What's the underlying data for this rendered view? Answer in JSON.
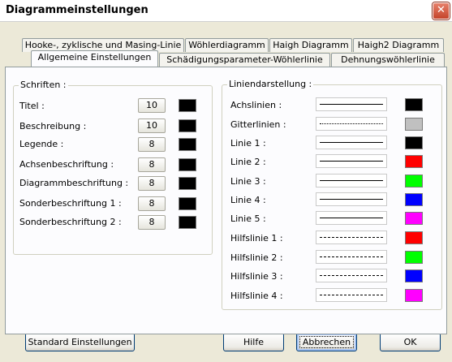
{
  "window": {
    "title": "Diagrammeinstellungen",
    "close_glyph": "✕"
  },
  "tabs_row1": [
    {
      "label": "Hooke-, zyklische und Masing-Linie"
    },
    {
      "label": "Wöhlerdiagramm"
    },
    {
      "label": "Haigh Diagramm"
    },
    {
      "label": "Haigh2 Diagramm"
    }
  ],
  "tabs_row2": [
    {
      "label": "Allgemeine Einstellungen",
      "active": true
    },
    {
      "label": "Schädigungsparameter-Wöhlerlinie"
    },
    {
      "label": "Dehnungswöhlerlinie"
    }
  ],
  "schriften": {
    "title": "Schriften :",
    "rows": [
      {
        "label": "Titel :",
        "size": "10",
        "color": "#000000"
      },
      {
        "label": "Beschreibung :",
        "size": "10",
        "color": "#000000"
      },
      {
        "label": "Legende :",
        "size": "8",
        "color": "#000000"
      },
      {
        "label": "Achsenbeschriftung :",
        "size": "8",
        "color": "#000000"
      },
      {
        "label": "Diagrammbeschriftung :",
        "size": "8",
        "color": "#000000"
      },
      {
        "label": "Sonderbeschriftung 1 :",
        "size": "8",
        "color": "#000000"
      },
      {
        "label": "Sonderbeschriftung 2 :",
        "size": "8",
        "color": "#000000"
      }
    ]
  },
  "linien": {
    "title": "Liniendarstellung :",
    "rows": [
      {
        "label": "Achslinien :",
        "style": "solid",
        "color": "#000000"
      },
      {
        "label": "Gitterlinien :",
        "style": "dotted",
        "color": "#C0C0C0"
      },
      {
        "label": "Linie 1 :",
        "style": "solid",
        "color": "#000000"
      },
      {
        "label": "Linie 2 :",
        "style": "solid",
        "color": "#FF0000"
      },
      {
        "label": "Linie 3 :",
        "style": "solid",
        "color": "#00FF00"
      },
      {
        "label": "Linie 4 :",
        "style": "solid",
        "color": "#0000FF"
      },
      {
        "label": "Linie 5 :",
        "style": "solid",
        "color": "#FF00FF"
      },
      {
        "label": "Hilfslinie 1 :",
        "style": "dashed",
        "color": "#FF0000"
      },
      {
        "label": "Hilfslinie 2 :",
        "style": "dashed",
        "color": "#00FF00"
      },
      {
        "label": "Hilfslinie 3 :",
        "style": "dashed",
        "color": "#0000FF"
      },
      {
        "label": "Hilfslinie 4 :",
        "style": "dashed",
        "color": "#FF00FF"
      }
    ]
  },
  "buttons": {
    "standard": "Standard Einstellungen",
    "hilfe": "Hilfe",
    "abbrechen": "Abbrechen",
    "ok": "OK"
  }
}
